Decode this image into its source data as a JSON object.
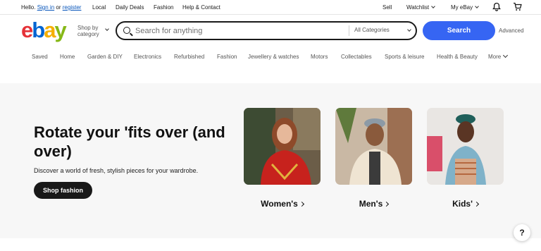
{
  "topbar": {
    "greeting": "Hello.",
    "sign_in": "Sign in",
    "or": "or",
    "register": "register",
    "links": [
      "Local",
      "Daily Deals",
      "Fashion",
      "Help & Contact"
    ],
    "sell": "Sell",
    "watchlist": "Watchlist",
    "my_ebay": "My eBay",
    "bell_icon": "bell-icon",
    "cart_icon": "cart-icon"
  },
  "header": {
    "logo": {
      "e": "e",
      "b": "b",
      "a": "a",
      "y": "y"
    },
    "shop_by_line1": "Shop by",
    "shop_by_line2": "category",
    "search_placeholder": "Search for anything",
    "category_select": "All Categories",
    "search_button": "Search",
    "advanced": "Advanced"
  },
  "nav": {
    "items": [
      "Saved",
      "Home",
      "Garden & DIY",
      "Electronics",
      "Refurbished",
      "Fashion",
      "Jewellery & watches",
      "Motors",
      "Collectables",
      "Sports & leisure",
      "Health & Beauty"
    ],
    "more": "More"
  },
  "hero": {
    "headline": "Rotate your 'fits over (and over)",
    "subtitle": "Discover a world of fresh, stylish pieces for your wardrobe.",
    "cta": "Shop fashion",
    "tiles": [
      {
        "label": "Women's"
      },
      {
        "label": "Men's"
      },
      {
        "label": "Kids'"
      }
    ]
  },
  "help_button": "?",
  "colors": {
    "search_button": "#3665f3",
    "link": "#0654ba",
    "hero_bg": "#f7f7f7"
  }
}
